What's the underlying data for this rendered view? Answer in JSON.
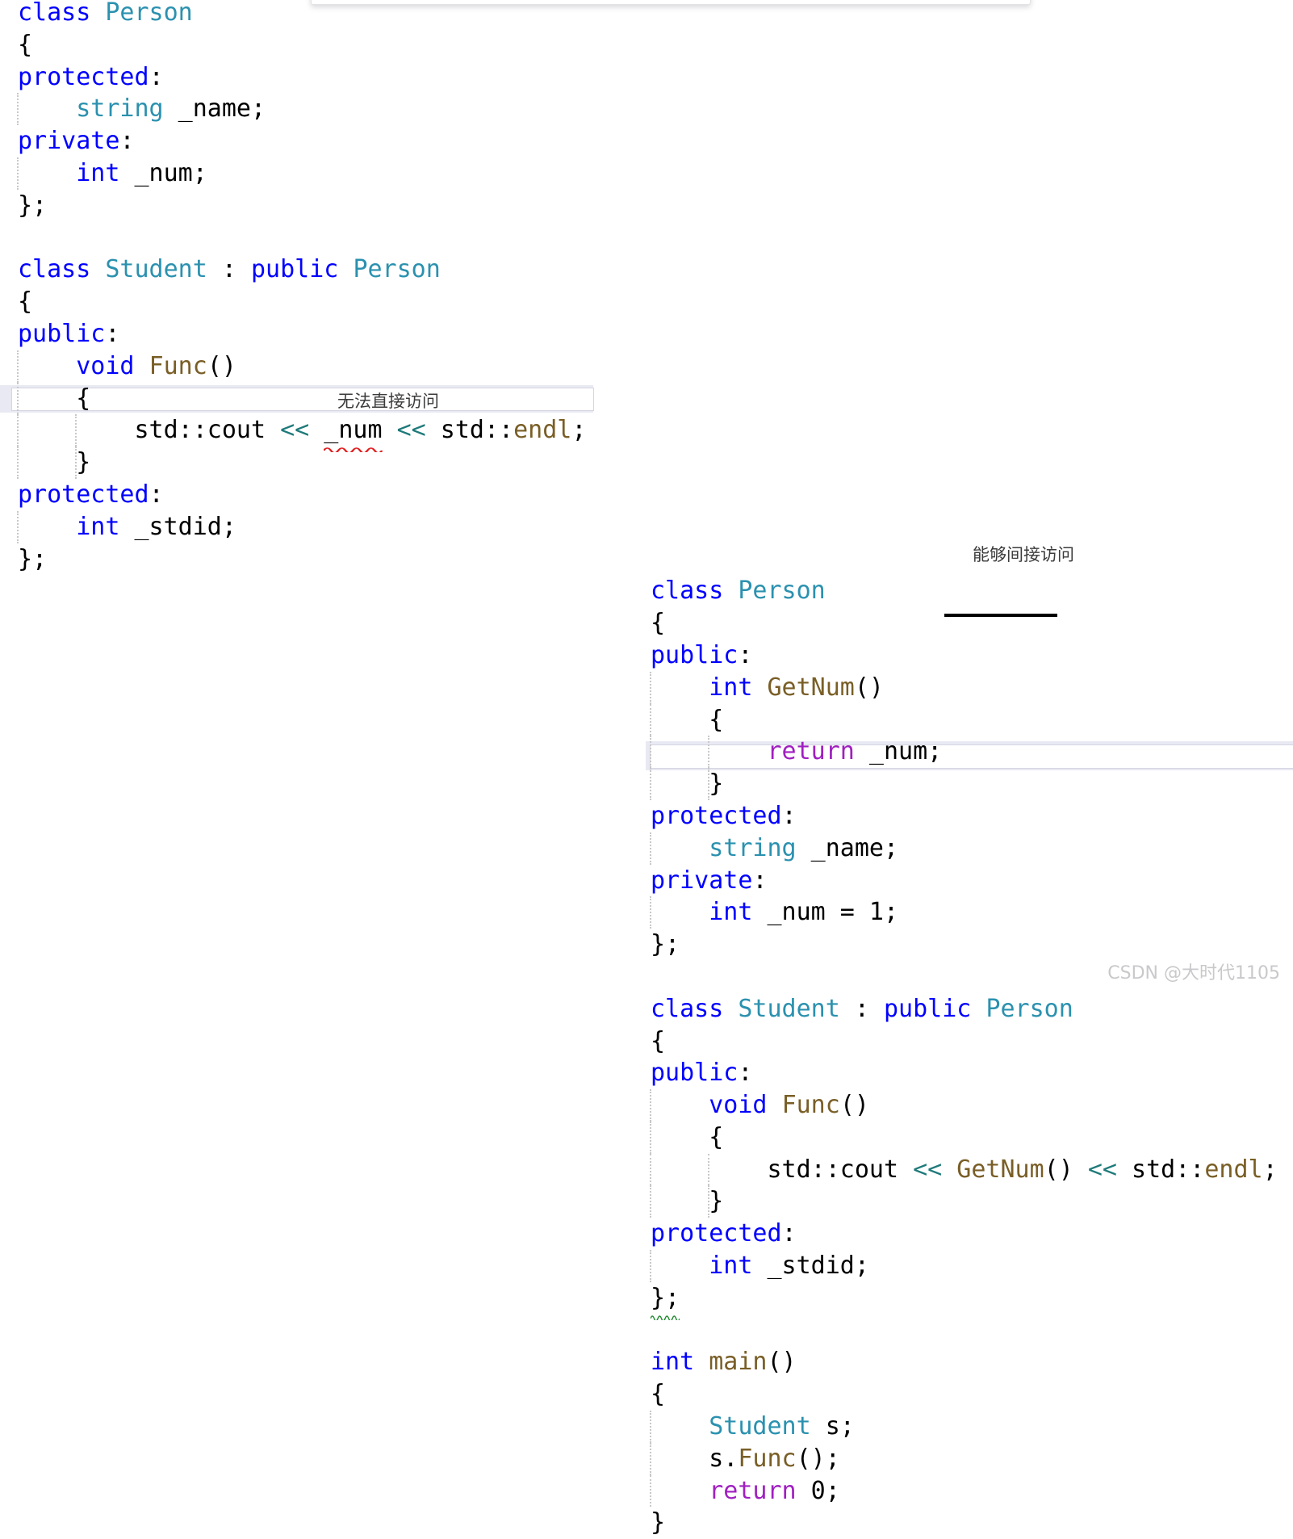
{
  "meta": {
    "watermark": "CSDN @大时代1105"
  },
  "annotations": {
    "left": "无法直接访问",
    "right": "能够间接访问"
  },
  "left_pane": {
    "title": "Person and Student without accessor",
    "lines": [
      {
        "tokens": [
          {
            "t": "class",
            "c": "kw"
          },
          {
            "t": " ",
            "c": "plain"
          },
          {
            "t": "Person",
            "c": "type"
          }
        ]
      },
      {
        "tokens": [
          {
            "t": "{",
            "c": "plain"
          }
        ]
      },
      {
        "tokens": [
          {
            "t": "protected",
            "c": "kw"
          },
          {
            "t": ":",
            "c": "plain"
          }
        ]
      },
      {
        "guides": [
          1
        ],
        "tokens": [
          {
            "t": "    ",
            "c": "plain"
          },
          {
            "t": "string",
            "c": "stdcls"
          },
          {
            "t": " _name;",
            "c": "plain"
          }
        ]
      },
      {
        "tokens": [
          {
            "t": "private",
            "c": "kw"
          },
          {
            "t": ":",
            "c": "plain"
          }
        ]
      },
      {
        "guides": [
          1
        ],
        "tokens": [
          {
            "t": "    ",
            "c": "plain"
          },
          {
            "t": "int",
            "c": "kw"
          },
          {
            "t": " _num;",
            "c": "plain"
          }
        ]
      },
      {
        "tokens": [
          {
            "t": "};",
            "c": "plain"
          }
        ]
      },
      {
        "tokens": [
          {
            "t": "",
            "c": "plain"
          }
        ]
      },
      {
        "tokens": [
          {
            "t": "class",
            "c": "kw"
          },
          {
            "t": " ",
            "c": "plain"
          },
          {
            "t": "Student",
            "c": "type"
          },
          {
            "t": " : ",
            "c": "plain"
          },
          {
            "t": "public",
            "c": "kw"
          },
          {
            "t": " ",
            "c": "plain"
          },
          {
            "t": "Person",
            "c": "type"
          }
        ]
      },
      {
        "tokens": [
          {
            "t": "{",
            "c": "plain"
          }
        ]
      },
      {
        "tokens": [
          {
            "t": "public",
            "c": "kw"
          },
          {
            "t": ":",
            "c": "plain"
          }
        ]
      },
      {
        "guides": [
          1
        ],
        "tokens": [
          {
            "t": "    ",
            "c": "plain"
          },
          {
            "t": "void",
            "c": "kw"
          },
          {
            "t": " ",
            "c": "plain"
          },
          {
            "t": "Func",
            "c": "fn"
          },
          {
            "t": "()",
            "c": "plain"
          }
        ]
      },
      {
        "guides": [
          1
        ],
        "tokens": [
          {
            "t": "    {",
            "c": "plain"
          }
        ]
      },
      {
        "guides": [
          1,
          2
        ],
        "tokens": [
          {
            "t": "        std::cout ",
            "c": "plain"
          },
          {
            "t": "<<",
            "c": "op"
          },
          {
            "t": " ",
            "c": "plain"
          },
          {
            "t": "_num",
            "c": "plain",
            "err": true
          },
          {
            "t": " ",
            "c": "plain"
          },
          {
            "t": "<<",
            "c": "op"
          },
          {
            "t": " std::",
            "c": "plain"
          },
          {
            "t": "endl",
            "c": "fn"
          },
          {
            "t": ";",
            "c": "plain"
          }
        ]
      },
      {
        "guides": [
          1,
          2
        ],
        "tokens": [
          {
            "t": "    }",
            "c": "plain"
          }
        ]
      },
      {
        "tokens": [
          {
            "t": "protected",
            "c": "kw"
          },
          {
            "t": ":",
            "c": "plain"
          }
        ]
      },
      {
        "guides": [
          1
        ],
        "tokens": [
          {
            "t": "    ",
            "c": "plain"
          },
          {
            "t": "int",
            "c": "kw"
          },
          {
            "t": " _stdid;",
            "c": "plain"
          }
        ]
      },
      {
        "tokens": [
          {
            "t": "};",
            "c": "plain"
          }
        ]
      }
    ]
  },
  "right_pane": {
    "title": "Person with GetNum accessor and main",
    "lines": [
      {
        "tokens": [
          {
            "t": "class",
            "c": "kw"
          },
          {
            "t": " ",
            "c": "plain"
          },
          {
            "t": "Person",
            "c": "type"
          }
        ]
      },
      {
        "tokens": [
          {
            "t": "{",
            "c": "plain"
          }
        ]
      },
      {
        "tokens": [
          {
            "t": "public",
            "c": "kw"
          },
          {
            "t": ":",
            "c": "plain"
          }
        ]
      },
      {
        "guides": [
          1
        ],
        "tokens": [
          {
            "t": "    ",
            "c": "plain"
          },
          {
            "t": "int",
            "c": "kw"
          },
          {
            "t": " ",
            "c": "plain"
          },
          {
            "t": "GetNum",
            "c": "fn"
          },
          {
            "t": "()",
            "c": "plain"
          }
        ]
      },
      {
        "guides": [
          1
        ],
        "tokens": [
          {
            "t": "    {",
            "c": "plain"
          }
        ]
      },
      {
        "guides": [
          1,
          2
        ],
        "tokens": [
          {
            "t": "        ",
            "c": "plain"
          },
          {
            "t": "return",
            "c": "ret"
          },
          {
            "t": " _num;",
            "c": "plain"
          }
        ]
      },
      {
        "guides": [
          1,
          2
        ],
        "tokens": [
          {
            "t": "    }",
            "c": "plain"
          }
        ]
      },
      {
        "tokens": [
          {
            "t": "protected",
            "c": "kw"
          },
          {
            "t": ":",
            "c": "plain"
          }
        ]
      },
      {
        "guides": [
          1
        ],
        "tokens": [
          {
            "t": "    ",
            "c": "plain"
          },
          {
            "t": "string",
            "c": "stdcls"
          },
          {
            "t": " _name;",
            "c": "plain"
          }
        ]
      },
      {
        "tokens": [
          {
            "t": "private",
            "c": "kw"
          },
          {
            "t": ":",
            "c": "plain"
          }
        ]
      },
      {
        "guides": [
          1
        ],
        "tokens": [
          {
            "t": "    ",
            "c": "plain"
          },
          {
            "t": "int",
            "c": "kw"
          },
          {
            "t": " _num = 1;",
            "c": "plain"
          }
        ]
      },
      {
        "tokens": [
          {
            "t": "};",
            "c": "plain"
          }
        ]
      },
      {
        "tokens": [
          {
            "t": "",
            "c": "plain"
          }
        ]
      },
      {
        "tokens": [
          {
            "t": "class",
            "c": "kw"
          },
          {
            "t": " ",
            "c": "plain"
          },
          {
            "t": "Student",
            "c": "type"
          },
          {
            "t": " : ",
            "c": "plain"
          },
          {
            "t": "public",
            "c": "kw"
          },
          {
            "t": " ",
            "c": "plain"
          },
          {
            "t": "Person",
            "c": "type"
          }
        ]
      },
      {
        "tokens": [
          {
            "t": "{",
            "c": "plain"
          }
        ]
      },
      {
        "tokens": [
          {
            "t": "public",
            "c": "kw"
          },
          {
            "t": ":",
            "c": "plain"
          }
        ]
      },
      {
        "guides": [
          1
        ],
        "tokens": [
          {
            "t": "    ",
            "c": "plain"
          },
          {
            "t": "void",
            "c": "kw"
          },
          {
            "t": " ",
            "c": "plain"
          },
          {
            "t": "Func",
            "c": "fn"
          },
          {
            "t": "()",
            "c": "plain"
          }
        ]
      },
      {
        "guides": [
          1
        ],
        "tokens": [
          {
            "t": "    {",
            "c": "plain"
          }
        ]
      },
      {
        "guides": [
          1,
          2
        ],
        "tokens": [
          {
            "t": "        std::cout ",
            "c": "plain"
          },
          {
            "t": "<<",
            "c": "op"
          },
          {
            "t": " ",
            "c": "plain"
          },
          {
            "t": "GetNum",
            "c": "fn"
          },
          {
            "t": "()",
            "c": "plain"
          },
          {
            "t": " ",
            "c": "plain"
          },
          {
            "t": "<<",
            "c": "op"
          },
          {
            "t": " std::",
            "c": "plain"
          },
          {
            "t": "endl",
            "c": "fn"
          },
          {
            "t": ";",
            "c": "plain"
          }
        ]
      },
      {
        "guides": [
          1,
          2
        ],
        "tokens": [
          {
            "t": "    }",
            "c": "plain"
          }
        ]
      },
      {
        "tokens": [
          {
            "t": "protected",
            "c": "kw"
          },
          {
            "t": ":",
            "c": "plain"
          }
        ]
      },
      {
        "guides": [
          1
        ],
        "tokens": [
          {
            "t": "    ",
            "c": "plain"
          },
          {
            "t": "int",
            "c": "kw"
          },
          {
            "t": " _stdid;",
            "c": "plain"
          }
        ]
      },
      {
        "tokens": [
          {
            "t": "};",
            "c": "plain",
            "warn": true
          }
        ]
      },
      {
        "tokens": [
          {
            "t": "",
            "c": "plain"
          }
        ]
      },
      {
        "tokens": [
          {
            "t": "int",
            "c": "kw"
          },
          {
            "t": " ",
            "c": "plain"
          },
          {
            "t": "main",
            "c": "fn"
          },
          {
            "t": "()",
            "c": "plain"
          }
        ]
      },
      {
        "tokens": [
          {
            "t": "{",
            "c": "plain"
          }
        ]
      },
      {
        "guides": [
          1
        ],
        "tokens": [
          {
            "t": "    ",
            "c": "plain"
          },
          {
            "t": "Student",
            "c": "type"
          },
          {
            "t": " s;",
            "c": "plain"
          }
        ]
      },
      {
        "guides": [
          1
        ],
        "tokens": [
          {
            "t": "    s.",
            "c": "plain"
          },
          {
            "t": "Func",
            "c": "fn"
          },
          {
            "t": "();",
            "c": "plain"
          }
        ]
      },
      {
        "guides": [
          1
        ],
        "tokens": [
          {
            "t": "    ",
            "c": "plain"
          },
          {
            "t": "return",
            "c": "ret"
          },
          {
            "t": " 0;",
            "c": "plain"
          }
        ]
      },
      {
        "tokens": [
          {
            "t": "}",
            "c": "plain"
          }
        ]
      }
    ]
  },
  "colors": {
    "keyword": "#0000ff",
    "type": "#2b91af",
    "function": "#795e26",
    "return_keyword": "#a020c0",
    "stream_operator": "#1f7a7a",
    "plain_text": "#000000",
    "error_squiggle": "#e02020",
    "warning_squiggle": "#1f8a2f",
    "highlight_band": "#e8e9f3",
    "watermark": "#c9c9cc"
  }
}
